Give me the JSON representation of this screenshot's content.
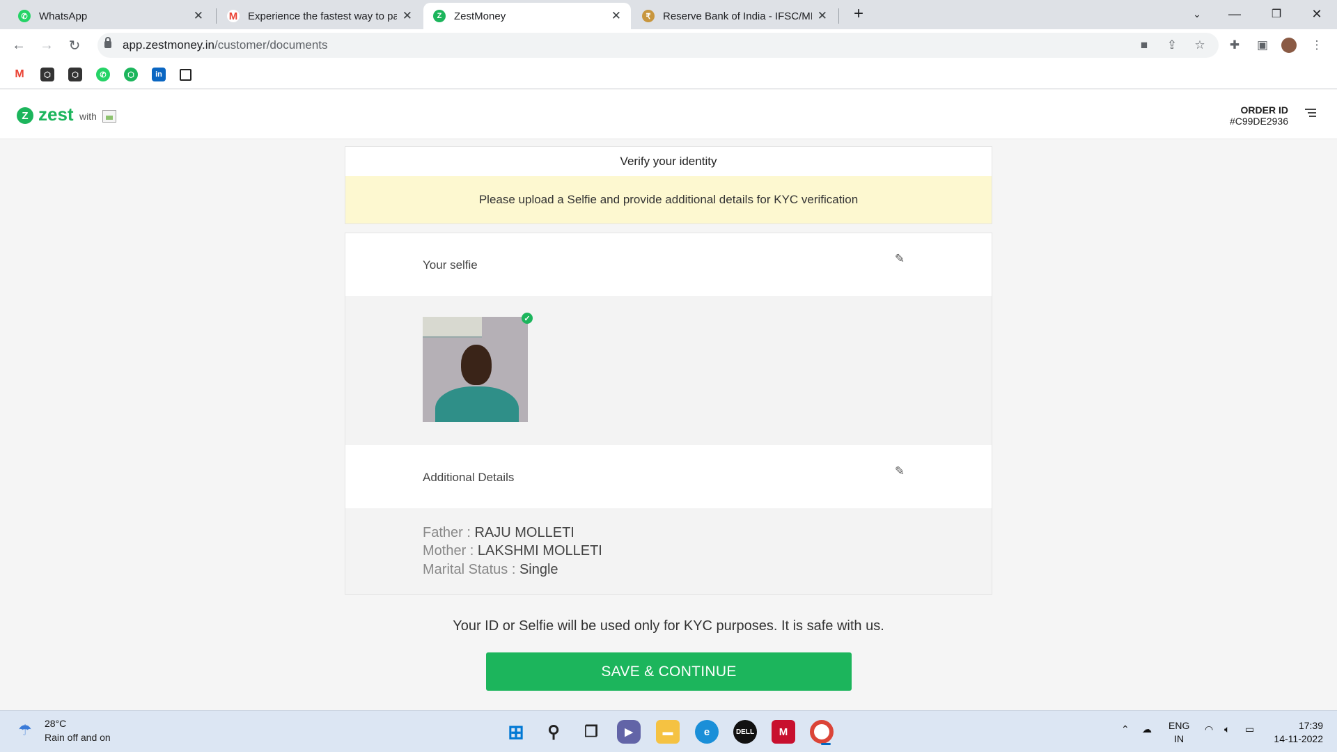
{
  "browser": {
    "tabs": [
      {
        "title": "WhatsApp",
        "favicon": "whatsapp-icon",
        "color": "#25d366"
      },
      {
        "title": "Experience the fastest way to pay",
        "favicon": "gmail-icon",
        "color": "#ea4335"
      },
      {
        "title": "ZestMoney",
        "favicon": "zest-icon",
        "color": "#1cb55c",
        "active": true
      },
      {
        "title": "Reserve Bank of India - IFSC/MIC",
        "favicon": "rbi-icon",
        "color": "#c8963e"
      }
    ],
    "url_host": "app.zestmoney.in",
    "url_path": "/customer/documents"
  },
  "app": {
    "brand": "zest",
    "brand_with": "with",
    "order_label": "ORDER ID",
    "order_id": "#C99DE2936",
    "accent": "#1cb55c"
  },
  "verify": {
    "title": "Verify your identity",
    "notice": "Please upload a Selfie and provide additional details for KYC verification",
    "notice_bg": "#fdf8d0"
  },
  "selfie_section": {
    "label": "Your selfie"
  },
  "details_section": {
    "label": "Additional Details",
    "fields": [
      {
        "key": "Father :",
        "value": "RAJU MOLLETI"
      },
      {
        "key": "Mother :",
        "value": "LAKSHMI MOLLETI"
      },
      {
        "key": "Marital Status :",
        "value": "Single"
      }
    ]
  },
  "footer": {
    "safe_note": "Your ID or Selfie will be used only for KYC purposes. It is safe with us.",
    "cta_label": "SAVE & CONTINUE"
  },
  "taskbar": {
    "temp": "28°C",
    "weather": "Rain off and on",
    "lang_top": "ENG",
    "lang_bottom": "IN",
    "time": "17:39",
    "date": "14-11-2022"
  }
}
